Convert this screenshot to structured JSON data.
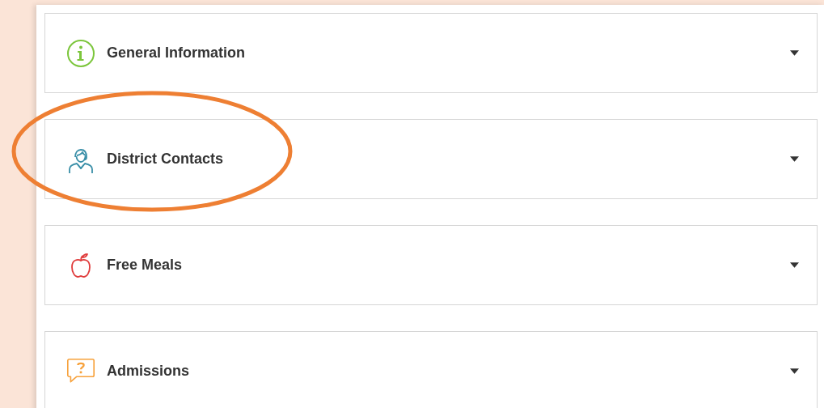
{
  "sections": [
    {
      "title": "General Information",
      "kind": "info",
      "expanded": false,
      "highlighted": false
    },
    {
      "title": "District Contacts",
      "kind": "person",
      "expanded": false,
      "highlighted": true
    },
    {
      "title": "Free Meals",
      "kind": "apple",
      "expanded": false,
      "highlighted": false
    },
    {
      "title": "Admissions",
      "kind": "question",
      "expanded": false,
      "highlighted": false
    }
  ]
}
